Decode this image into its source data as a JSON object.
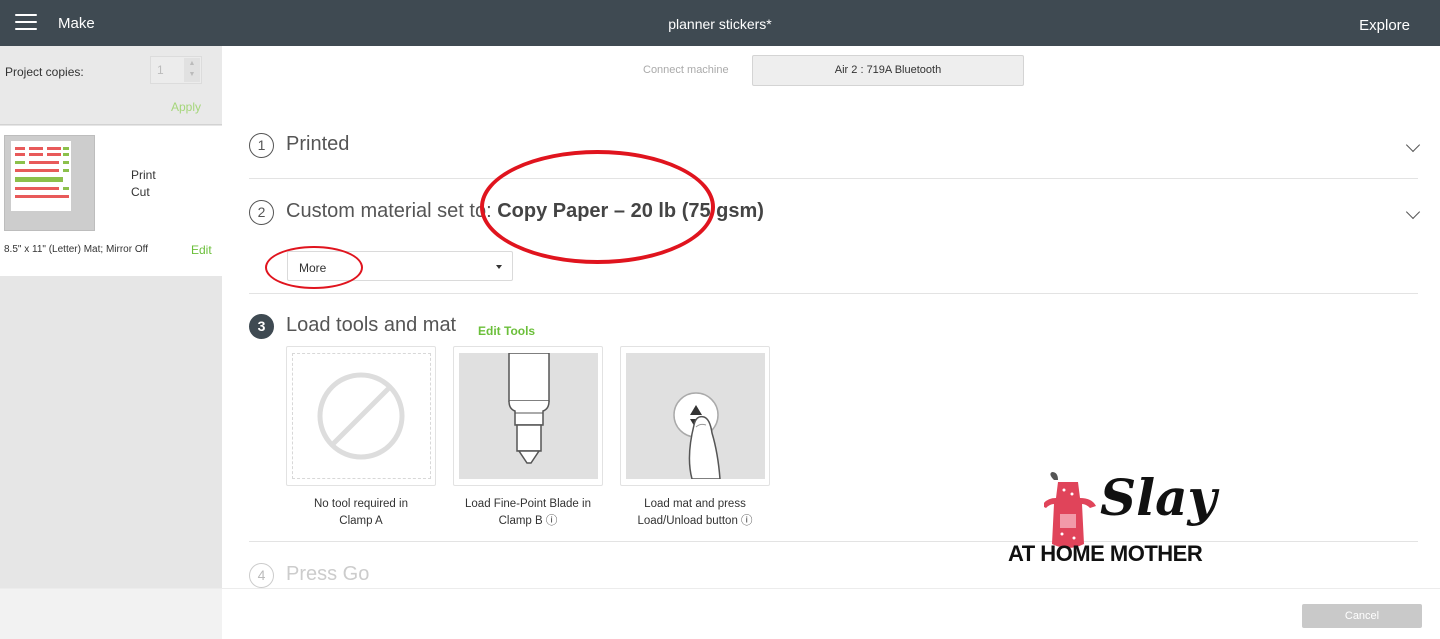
{
  "topbar": {
    "make_label": "Make",
    "project_title": "planner stickers*",
    "explore_label": "Explore"
  },
  "sidebar": {
    "copies_label": "Project copies:",
    "copies_value": "1",
    "apply_label": "Apply",
    "mat": {
      "print_label": "Print",
      "cut_label": "Cut",
      "info": "8.5\" x 11\" (Letter) Mat; Mirror Off",
      "edit_label": "Edit"
    }
  },
  "machine": {
    "connect_label": "Connect machine",
    "machine_name": "Air 2 : 719A Bluetooth"
  },
  "steps": [
    {
      "number": "1",
      "title": "Printed"
    },
    {
      "number": "2",
      "title_prefix": "Custom material set to: ",
      "material": "Copy Paper – 20 lb (75 gsm)",
      "dropdown_value": "More"
    },
    {
      "number": "3",
      "title": "Load tools and mat",
      "edit_tools_label": "Edit Tools"
    },
    {
      "number": "4",
      "title": "Press Go"
    }
  ],
  "tools": [
    {
      "caption_line1": "No tool required in",
      "caption_line2": "Clamp A",
      "icon": "no-tool-icon"
    },
    {
      "caption_line1": "Load Fine-Point Blade in",
      "caption_line2": "Clamp B ⓘ",
      "icon": "fine-point-blade-icon"
    },
    {
      "caption_line1": "Load mat and press",
      "caption_line2": "Load/Unload button ⓘ",
      "icon": "load-unload-button-icon"
    }
  ],
  "footer": {
    "cancel_label": "Cancel"
  },
  "watermark": {
    "line1": "Slay",
    "line2": "AT HOME MOTHER"
  },
  "colors": {
    "topbar": "#3f4a52",
    "accent_green": "#6bbf3a",
    "annotation_red": "#e0141e"
  }
}
